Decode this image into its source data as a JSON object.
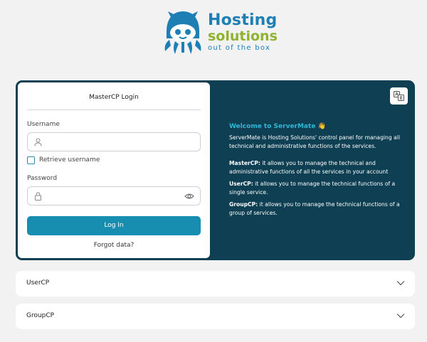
{
  "brand": {
    "line1": "Hosting",
    "line2": "solutions",
    "tagline": "out of the box",
    "primary_color": "#1e7fb5",
    "secondary_color": "#8fb22f",
    "mascot_icon": "hooded-octopus-mascot-icon"
  },
  "login": {
    "title": "MasterCP Login",
    "username_label": "Username",
    "username_value": "",
    "username_icon": "user-icon",
    "retrieve_label": "Retrieve username",
    "retrieve_checked": false,
    "password_label": "Password",
    "password_value": "",
    "password_icon": "lock-icon",
    "toggle_icon": "eye-icon",
    "button_label": "Log In",
    "forgot_label": "Forgot data?",
    "button_color": "#178db0"
  },
  "info": {
    "translate_icon": "translate-icon",
    "welcome_title": "Welcome to ServerMate 👋",
    "intro": "ServerMate is Hosting Solutions' control panel for managing all technical and administrative functions of the services.",
    "items": [
      {
        "term": "MasterCP:",
        "text": " it allows you to manage the technical and administrative functions of all the services in your account"
      },
      {
        "term": "UserCP:",
        "text": " it allows you to manage the technical functions of a single service."
      },
      {
        "term": "GroupCP:",
        "text": " it allows you to manage the technical functions of a group of services."
      }
    ],
    "panel_color": "#0f3f52",
    "accent_color": "#31b7d6"
  },
  "accordions": [
    {
      "label": "UserCP",
      "icon": "chevron-down-icon"
    },
    {
      "label": "GroupCP",
      "icon": "chevron-down-icon"
    }
  ]
}
